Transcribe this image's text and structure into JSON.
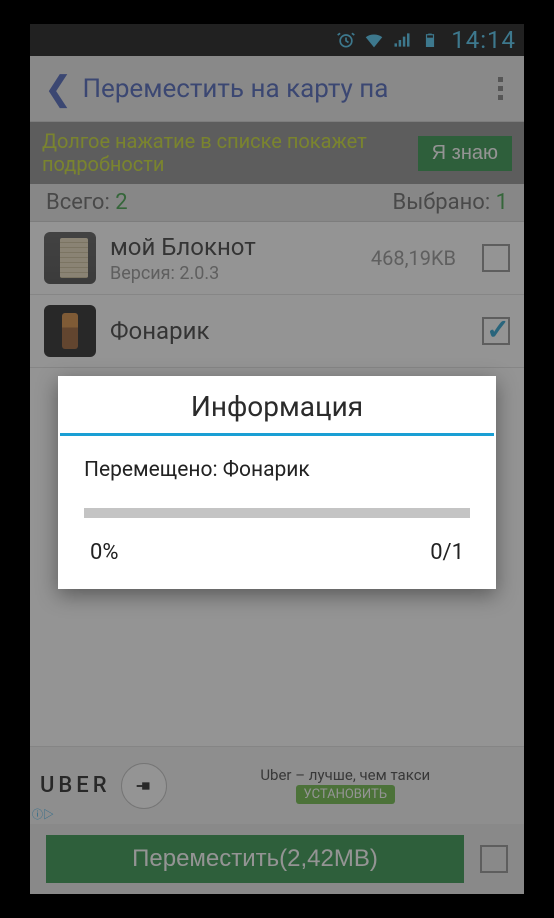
{
  "status": {
    "time": "14:14"
  },
  "appbar": {
    "title": "Переместить на карту па"
  },
  "tip": {
    "text": "Долгое нажатие в списке покажет подробности",
    "button": "Я знаю"
  },
  "counts": {
    "total_label": "Всего: ",
    "total_value": "2",
    "selected_label": "Выбрано: ",
    "selected_value": "1"
  },
  "apps": [
    {
      "name": "мой Блокнот",
      "version_label": "Версия: 2.0.3",
      "size": "468,19KB",
      "checked": false
    },
    {
      "name": "Фонарик",
      "version_label": "",
      "size": "",
      "checked": true
    }
  ],
  "ad": {
    "brand": "UBER",
    "tagline": "Uber – лучше, чем такси",
    "cta": "УСТАНОВИТЬ"
  },
  "bottom": {
    "button": "Переместить(2,42MB)"
  },
  "dialog": {
    "title": "Информация",
    "message": "Перемещено: Фонарик",
    "percent": "0%",
    "count": "0/1"
  }
}
